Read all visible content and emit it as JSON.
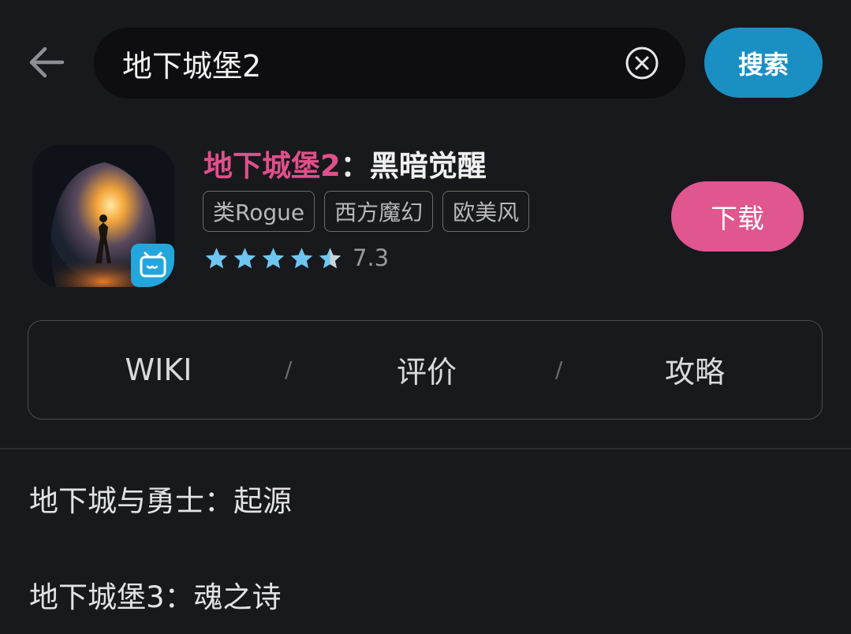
{
  "search": {
    "value": "地下城堡2",
    "button_label": "搜索"
  },
  "game": {
    "title_highlight": "地下城堡2",
    "title_rest": "：黑暗觉醒",
    "tags": [
      "类Rogue",
      "西方魔幻",
      "欧美风"
    ],
    "rating": "7.3",
    "stars_filled": 4.5,
    "stars_total": 5,
    "download_label": "下载"
  },
  "tabs": {
    "items": [
      "WIKI",
      "评价",
      "攻略"
    ],
    "separator": "/"
  },
  "suggestions": [
    "地下城与勇士：起源",
    "地下城堡3：魂之诗"
  ],
  "colors": {
    "accent_blue": "#1a8fc3",
    "accent_pink": "#e0568e",
    "star_blue": "#6ec6f0"
  },
  "icons": {
    "back": "arrow-left-icon",
    "clear": "clear-circle-icon",
    "badge": "bilibili-tv-icon",
    "star": "star-icon"
  }
}
